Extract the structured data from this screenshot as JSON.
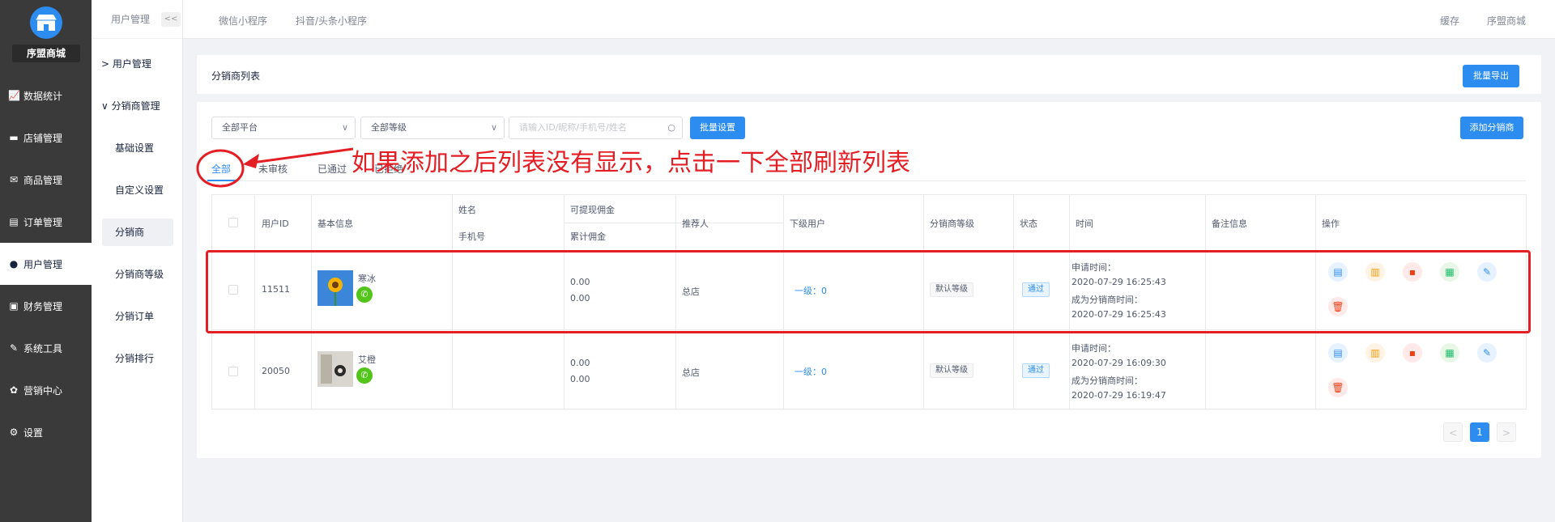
{
  "sidebar": {
    "shop_name": "序盟商城",
    "items": [
      {
        "label": "数据统计",
        "icon": "chart-icon"
      },
      {
        "label": "店铺管理",
        "icon": "store-icon"
      },
      {
        "label": "商品管理",
        "icon": "goods-icon"
      },
      {
        "label": "订单管理",
        "icon": "order-icon"
      },
      {
        "label": "用户管理",
        "icon": "user-icon"
      },
      {
        "label": "财务管理",
        "icon": "finance-icon"
      },
      {
        "label": "系统工具",
        "icon": "wrench-icon"
      },
      {
        "label": "营销中心",
        "icon": "marketing-icon"
      },
      {
        "label": "设置",
        "icon": "gear-icon"
      }
    ]
  },
  "submenu": {
    "header": "用户管理",
    "collapse_label": "<<",
    "groups": [
      {
        "label": "用户管理",
        "chevron": ">"
      },
      {
        "label": "分销商管理",
        "chevron": "∨"
      }
    ],
    "items": [
      "基础设置",
      "自定义设置",
      "分销商",
      "分销商等级",
      "分销订单",
      "分销排行"
    ]
  },
  "topbar": {
    "tabs": [
      "微信小程序",
      "抖音/头条小程序"
    ],
    "right": [
      "缓存",
      "序盟商城"
    ]
  },
  "page": {
    "title": "分销商列表",
    "export_button": "批量导出"
  },
  "filters": {
    "platform": "全部平台",
    "level": "全部等级",
    "search_placeholder": "请输入ID/昵称/手机号/姓名",
    "batch_button": "批量设置",
    "add_button": "添加分销商"
  },
  "tabs": [
    "全部",
    "未审核",
    "已通过",
    "已拒绝"
  ],
  "annotation": "如果添加之后列表没有显示，点击一下全部刷新列表",
  "table": {
    "headers": {
      "user_id": "用户ID",
      "basic_info": "基本信息",
      "name": "姓名",
      "phone": "手机号",
      "withdrawable": "可提现佣金",
      "total": "累计佣金",
      "referrer": "推荐人",
      "subordinates": "下级用户",
      "level": "分销商等级",
      "status": "状态",
      "time": "时间",
      "remark": "备注信息",
      "actions": "操作"
    },
    "rows": [
      {
        "id": "11511",
        "nickname": "寒冰",
        "withdrawable": "0.00",
        "total": "0.00",
        "referrer": "总店",
        "subordinates": "一级：0",
        "level": "默认等级",
        "status": "通过",
        "apply_label": "申请时间：",
        "apply_time": "2020-07-29 16:25:43",
        "become_label": "成为分销商时间：",
        "become_time": "2020-07-29 16:25:43"
      },
      {
        "id": "20050",
        "nickname": "艾橙",
        "withdrawable": "0.00",
        "total": "0.00",
        "referrer": "总店",
        "subordinates": "一级：0",
        "level": "默认等级",
        "status": "通过",
        "apply_label": "申请时间：",
        "apply_time": "2020-07-29 16:09:30",
        "become_label": "成为分销商时间：",
        "become_time": "2020-07-29 16:19:47"
      }
    ]
  },
  "pagination": {
    "prev": "<",
    "current": "1",
    "next": ">"
  }
}
